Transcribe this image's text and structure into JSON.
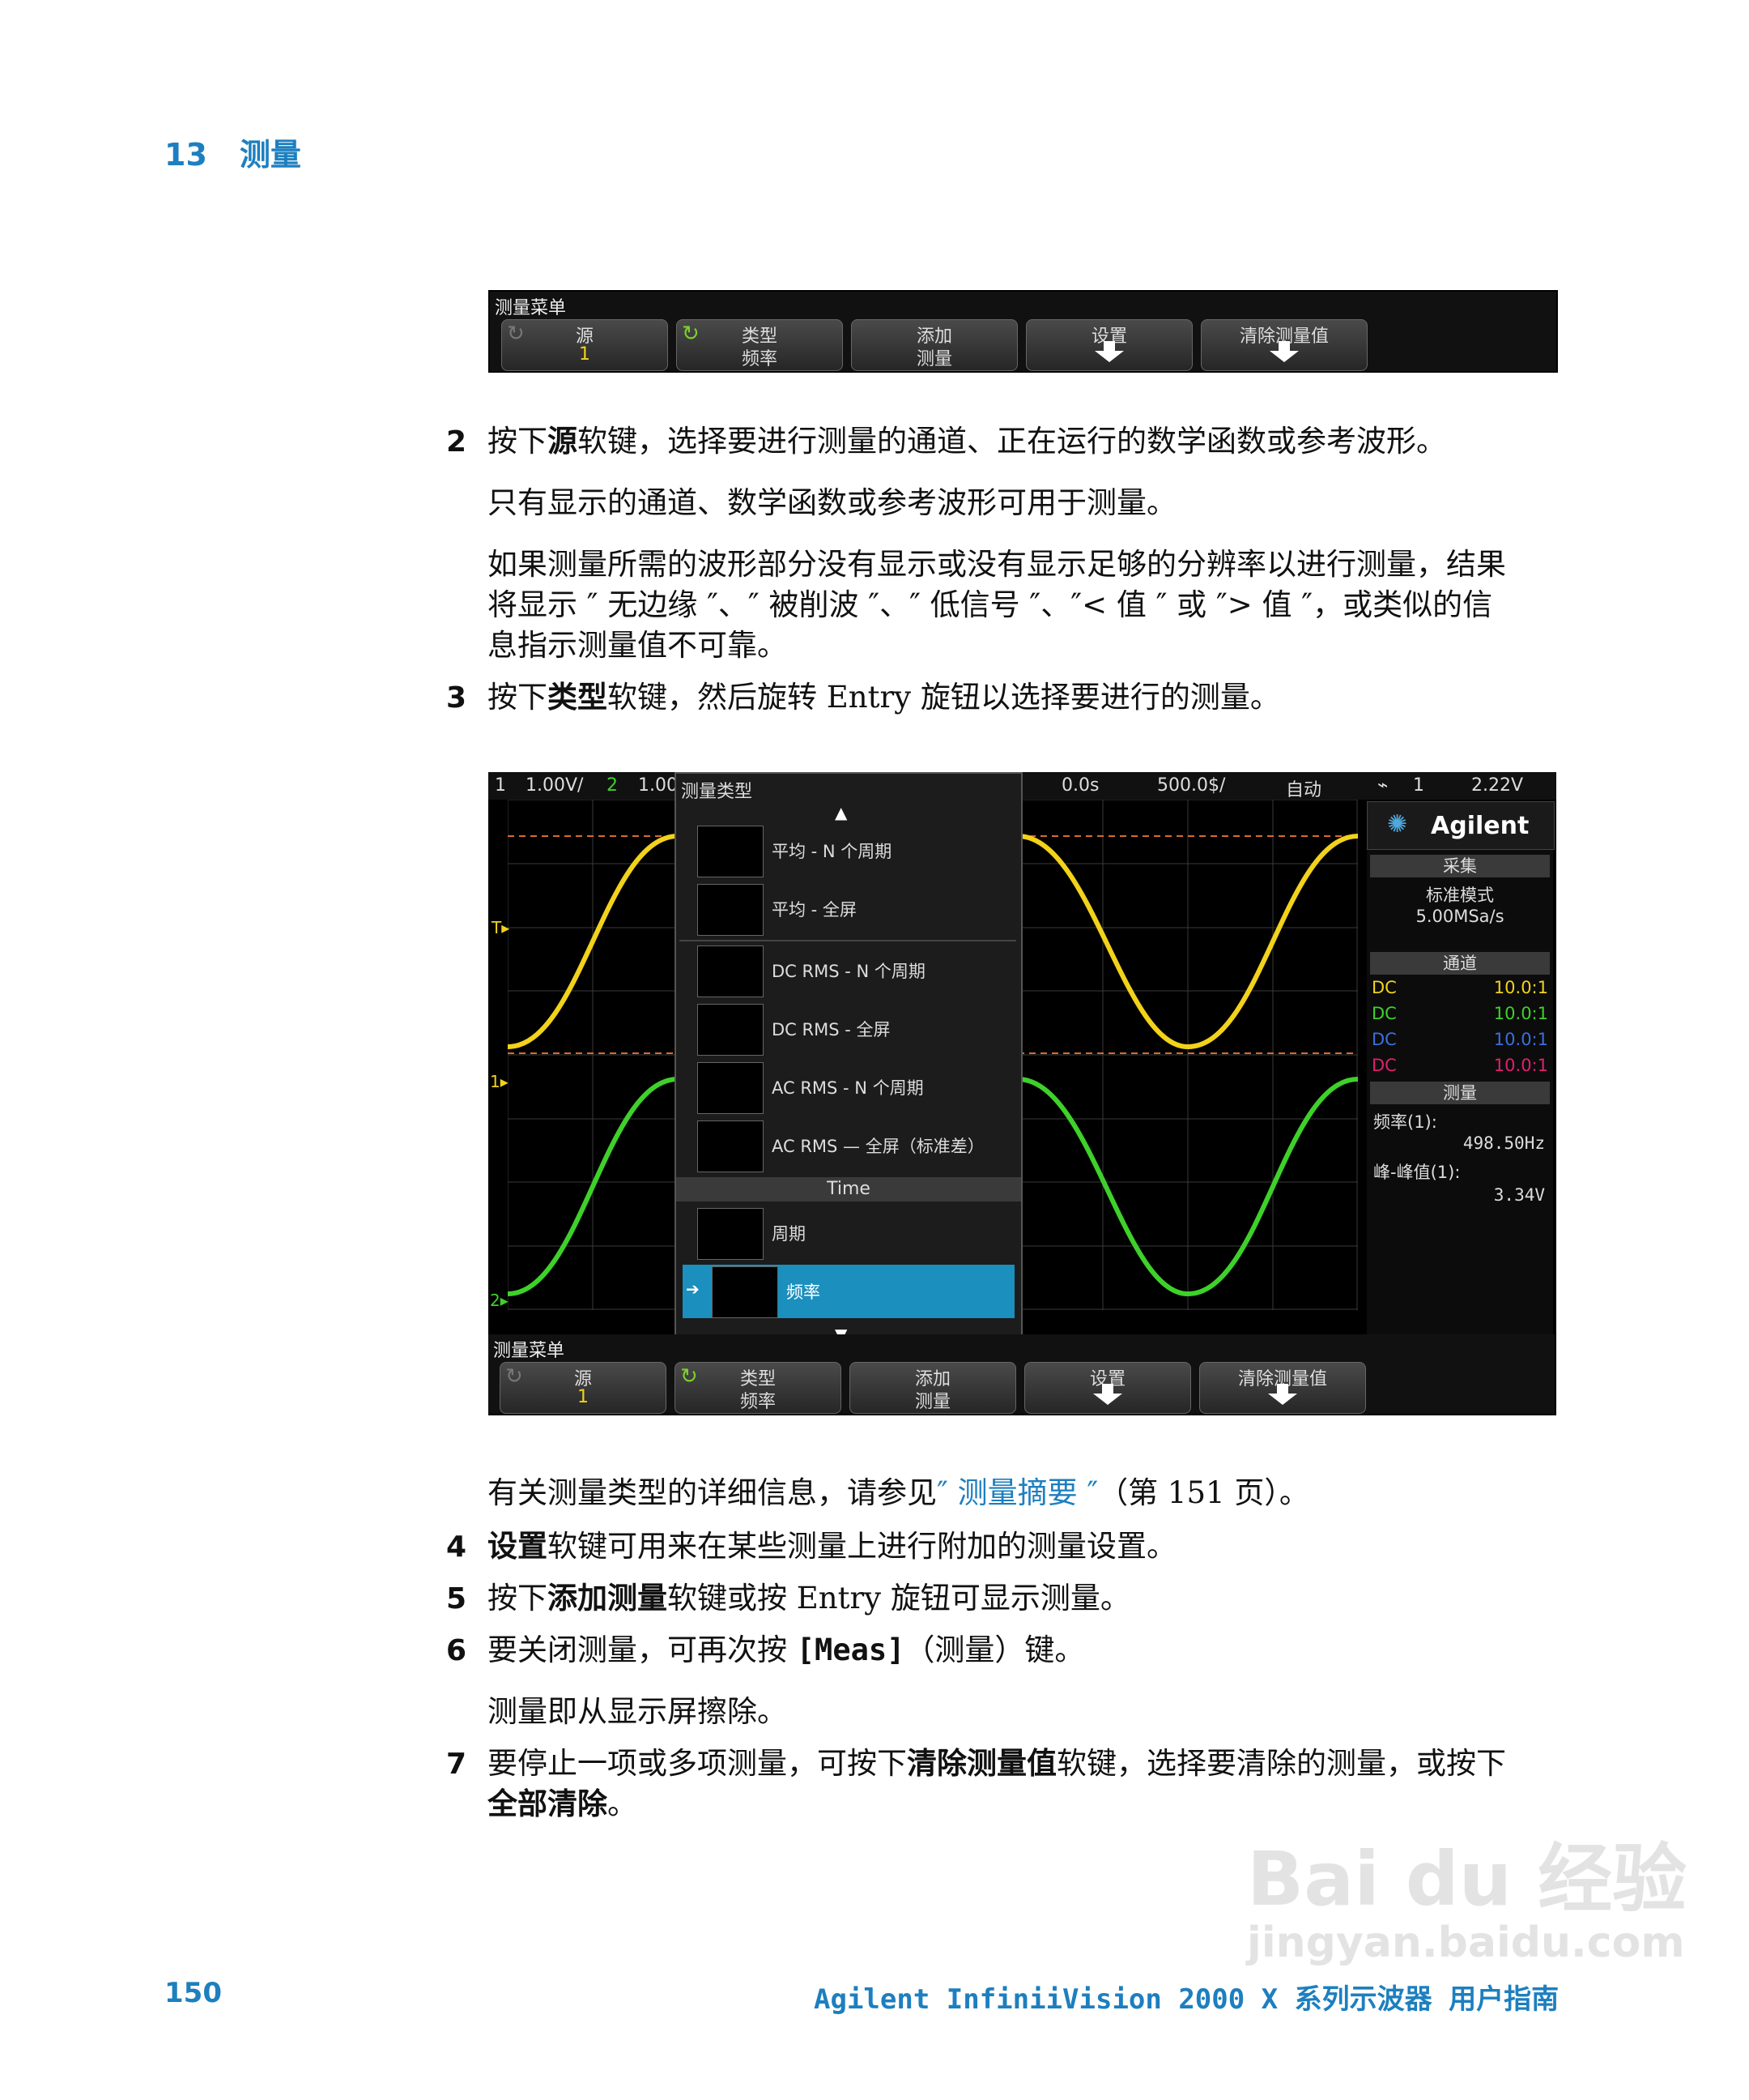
{
  "header": {
    "chapter": "13",
    "title": "测量"
  },
  "softkeys_top": {
    "menu_title": "测量菜单",
    "keys": [
      {
        "line1": "源",
        "line2": "1"
      },
      {
        "line1": "类型",
        "line2": "频率"
      },
      {
        "line1": "添加",
        "line2": "测量"
      },
      {
        "line1": "设置",
        "line2": ""
      },
      {
        "line1": "清除测量值",
        "line2": ""
      }
    ]
  },
  "steps": {
    "s2_num": "2",
    "s2_pre": "按下",
    "s2_bold": "源",
    "s2_post": "软键，选择要进行测量的通道、正在运行的数学函数或参考波形。",
    "p1": "只有显示的通道、数学函数或参考波形可用于测量。",
    "p2_l1": "如果测量所需的波形部分没有显示或没有显示足够的分辨率以进行测量，结果",
    "p2_l2": "将显示 ″ 无边缘 ″、″ 被削波 ″、″ 低信号 ″、″< 值 ″ 或 ″> 值 ″，或类似的信",
    "p2_l3": "息指示测量值不可靠。",
    "s3_num": "3",
    "s3_pre": "按下",
    "s3_bold": "类型",
    "s3_post": "软键，然后旋转 Entry 旋钮以选择要进行的测量。",
    "ref_pre": "有关测量类型的详细信息，请参见",
    "ref_link": "″ 测量摘要 ″",
    "ref_post": "（第 151 页）。",
    "s4_num": "4",
    "s4_bold": "设置",
    "s4_post": "软键可用来在某些测量上进行附加的测量设置。",
    "s5_num": "5",
    "s5_pre": "按下",
    "s5_bold": "添加测量",
    "s5_post": "软键或按 Entry 旋钮可显示测量。",
    "s6_num": "6",
    "s6_pre": "要关闭测量，可再次按 ",
    "s6_bold": "[Meas]",
    "s6_post": "（测量）键。",
    "p3": "测量即从显示屏擦除。",
    "s7_num": "7",
    "s7_pre": "要停止一项或多项测量，可按下",
    "s7_bold": "清除测量值",
    "s7_post": "软键，选择要清除的测量，或按下",
    "s7_bold2": "全部清除",
    "s7_end": "。"
  },
  "scope": {
    "topbar": {
      "ch1": "1",
      "ch1_scale": "1.00V/",
      "ch2": "2",
      "ch2_scale": "1.00",
      "time_delay": "0.0s",
      "time_scale": "500.0$/",
      "trig_mode": "自动",
      "trig_src": "1",
      "trig_level": "2.22V"
    },
    "menu": {
      "title": "测量类型",
      "items": [
        {
          "label": "平均 - N 个周期",
          "tag": "cycle"
        },
        {
          "label": "平均 - 全屏",
          "tag": "FS"
        },
        {
          "label": "DC RMS - N 个周期",
          "tag": "cycle"
        },
        {
          "label": "DC RMS - 全屏",
          "tag": "FS"
        },
        {
          "label": "AC RMS - N 个周期",
          "tag": "cycle"
        },
        {
          "label": "AC RMS — 全屏（标准差）",
          "tag": "FS"
        }
      ],
      "section": "Time",
      "time_items": [
        {
          "label": "周期"
        },
        {
          "label": "频率"
        }
      ]
    },
    "panel": {
      "brand": "Agilent",
      "acq_title": "采集",
      "acq_mode": "标准模式",
      "acq_rate": "5.00MSa/s",
      "chan_title": "通道",
      "channels": [
        {
          "coupling": "DC",
          "probe": "10.0:1",
          "color": "#f2d21a"
        },
        {
          "coupling": "DC",
          "probe": "10.0:1",
          "color": "#3ed12a"
        },
        {
          "coupling": "DC",
          "probe": "10.0:1",
          "color": "#3a6fe0"
        },
        {
          "coupling": "DC",
          "probe": "10.0:1",
          "color": "#e0206e"
        }
      ],
      "meas_title": "测量",
      "m1_label": "频率(1):",
      "m1_value": "498.50Hz",
      "m2_label": "峰-峰值(1):",
      "m2_value": "3.34V"
    },
    "softkeys": {
      "menu_title": "测量菜单",
      "keys": [
        {
          "line1": "源",
          "line2": "1"
        },
        {
          "line1": "类型",
          "line2": "频率"
        },
        {
          "line1": "添加",
          "line2": "测量"
        },
        {
          "line1": "设置",
          "line2": ""
        },
        {
          "line1": "清除测量值",
          "line2": ""
        }
      ]
    }
  },
  "footer": {
    "page": "150",
    "book": "Agilent InfiniiVision 2000 X 系列示波器 用户指南"
  },
  "watermark": {
    "line1": "Bai du 经验",
    "line2": "jingyan.baidu.com"
  },
  "colors": {
    "accent": "#1d7fbf",
    "ch1": "#f2d21a",
    "ch2": "#3ed12a",
    "highlight": "#1b8fbd"
  }
}
